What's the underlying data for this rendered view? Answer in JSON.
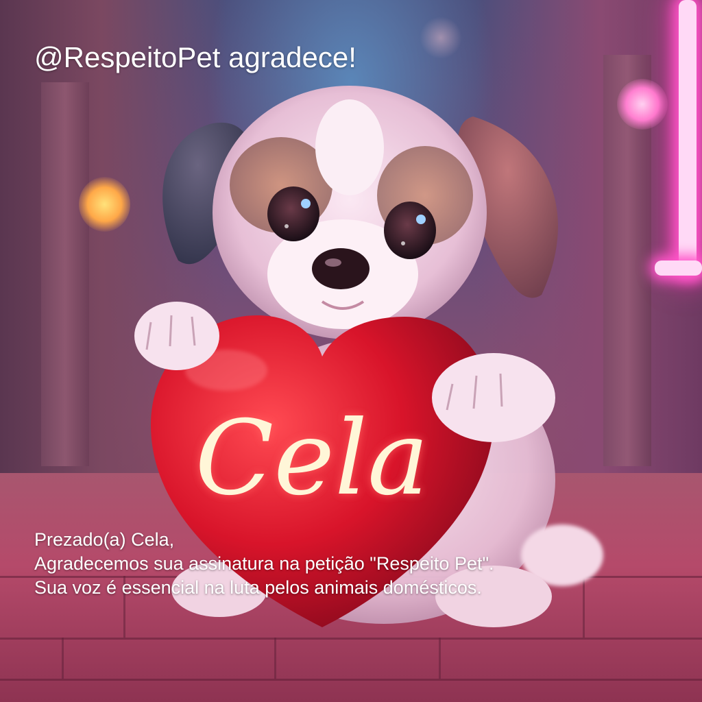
{
  "heading": "@RespeitoPet agradece!",
  "message": {
    "greeting": "Prezado(a) Cela,",
    "line1": "Agradecemos sua assinatura na petição \"Respeito Pet\".",
    "line2": "Sua voz é essencial na luta pelos animais domésticos."
  },
  "heart": {
    "name": "Cela",
    "color": "#d8142a",
    "text_color": "#fff6d8"
  },
  "colors": {
    "neon_pink": "#ff55c9",
    "lamp_orange": "#ffa848"
  }
}
